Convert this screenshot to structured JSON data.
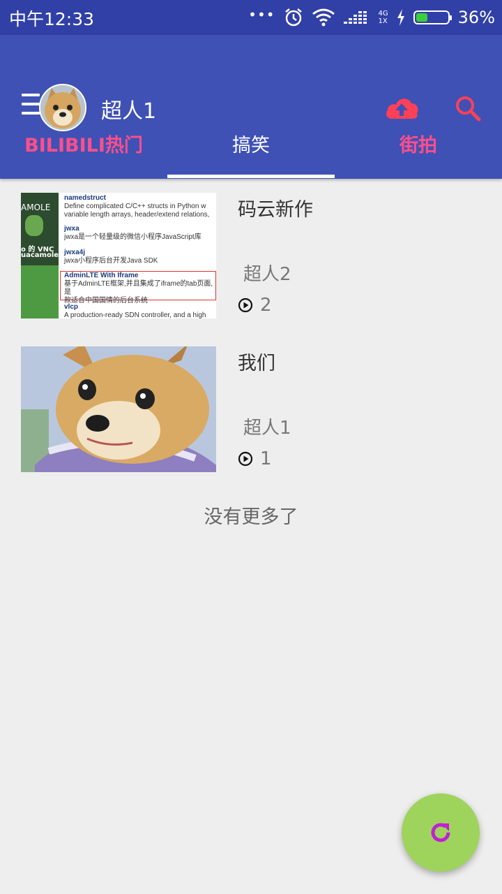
{
  "status_bar": {
    "time": "中午12:33",
    "dots": "•••",
    "network_top": "4G",
    "network_bottom": "1X",
    "battery_percent": "36%",
    "battery_level": 0.36,
    "icons": [
      "alarm-icon",
      "wifi-icon",
      "signal-icon",
      "charging-icon",
      "battery-icon"
    ]
  },
  "app_bar": {
    "user_name": "超人1",
    "menu_icon": "menu-icon",
    "upload_icon": "cloud-upload-icon",
    "search_icon": "search-icon",
    "accent_color": "#ff4f8a",
    "background_color": "#3f51b5"
  },
  "tabs": [
    {
      "label": "BILIBILI热门",
      "active": false
    },
    {
      "label": "搞笑",
      "active": true
    },
    {
      "label": "街拍",
      "active": false
    }
  ],
  "videos": [
    {
      "title": "码云新作",
      "author": "超人2",
      "views": "2",
      "thumbnail_text": {
        "left_labels": [
          "AMOLE",
          "o 的 VNC",
          "uacamole"
        ],
        "rows": [
          {
            "name": "namedstruct",
            "desc": "Define complicated C/C++ structs in Python w",
            "desc2": "variable length arrays, header/extend relations,"
          },
          {
            "name": "jwxa",
            "desc": "jwxa是一个轻量级的微信小程序JavaScript库"
          },
          {
            "name": "jwxa4j",
            "desc": "jwxa小程序后台开发Java SDK"
          },
          {
            "name": "AdminLTE With Iframe",
            "desc": "基于AdminLTE框架,并且集成了iframe的tab页面,是",
            "desc2": "款适合中国国情的后台系统"
          },
          {
            "name": "vlcp",
            "desc": "A production-ready SDN controller, and a high"
          }
        ]
      }
    },
    {
      "title": "我们",
      "author": "超人1",
      "views": "1"
    }
  ],
  "list_footer": "没有更多了",
  "fab": {
    "icon": "refresh-icon",
    "color": "#9ed45c",
    "icon_color": "#c21fd6"
  }
}
